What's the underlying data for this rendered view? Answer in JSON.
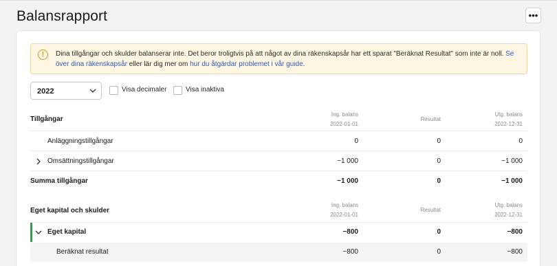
{
  "header": {
    "title": "Balansrapport",
    "more_label": "•••"
  },
  "alert": {
    "icon": "warning-circle-icon",
    "icon_glyph": "!",
    "text_main": "Dina tillgångar och skulder balanserar inte. Det beror troligtvis på att något av dina räkenskapsår har ett sparat \"Beräknat Resultat\" som inte är noll. ",
    "link1": "Se över dina räkenskapsår",
    "text_mid": " eller lär dig mer om ",
    "link2": "hur du åtgärdar problemet i vår guide",
    "text_end": ".",
    "colors": {
      "background": "#fdf6e2",
      "border": "#f1d98b",
      "link": "#2f57c7"
    }
  },
  "filters": {
    "year": "2022",
    "show_decimals_label": "Visa decimaler",
    "show_inactive_label": "Visa inaktiva"
  },
  "assets": {
    "title": "Tillgångar",
    "col_opening_label": "Ing. balans",
    "col_opening_date": "2022-01-01",
    "col_result_label": "Resultat",
    "col_closing_label": "Utg. balans",
    "col_closing_date": "2022-12-31",
    "rows": [
      {
        "label": "Anläggningstillgångar",
        "opening": "0",
        "result": "0",
        "closing": "0"
      },
      {
        "label": "Omsättningstillgångar",
        "opening": "−1 000",
        "result": "0",
        "closing": "−1 000"
      }
    ],
    "total": {
      "label": "Summa tillgångar",
      "opening": "−1 000",
      "result": "0",
      "closing": "−1 000"
    }
  },
  "equity": {
    "title": "Eget kapital och skulder",
    "col_opening_label": "Ing. balans",
    "col_opening_date": "2022-01-01",
    "col_result_label": "Resultat",
    "col_closing_label": "Utg. balans",
    "col_closing_date": "2022-12-31",
    "group": {
      "label": "Eget kapital",
      "opening": "−800",
      "result": "0",
      "closing": "−800"
    },
    "child": {
      "label": "Beräknat resultat",
      "opening": "−800",
      "result": "0",
      "closing": "−800"
    },
    "accent_color": "#3a9a54"
  }
}
